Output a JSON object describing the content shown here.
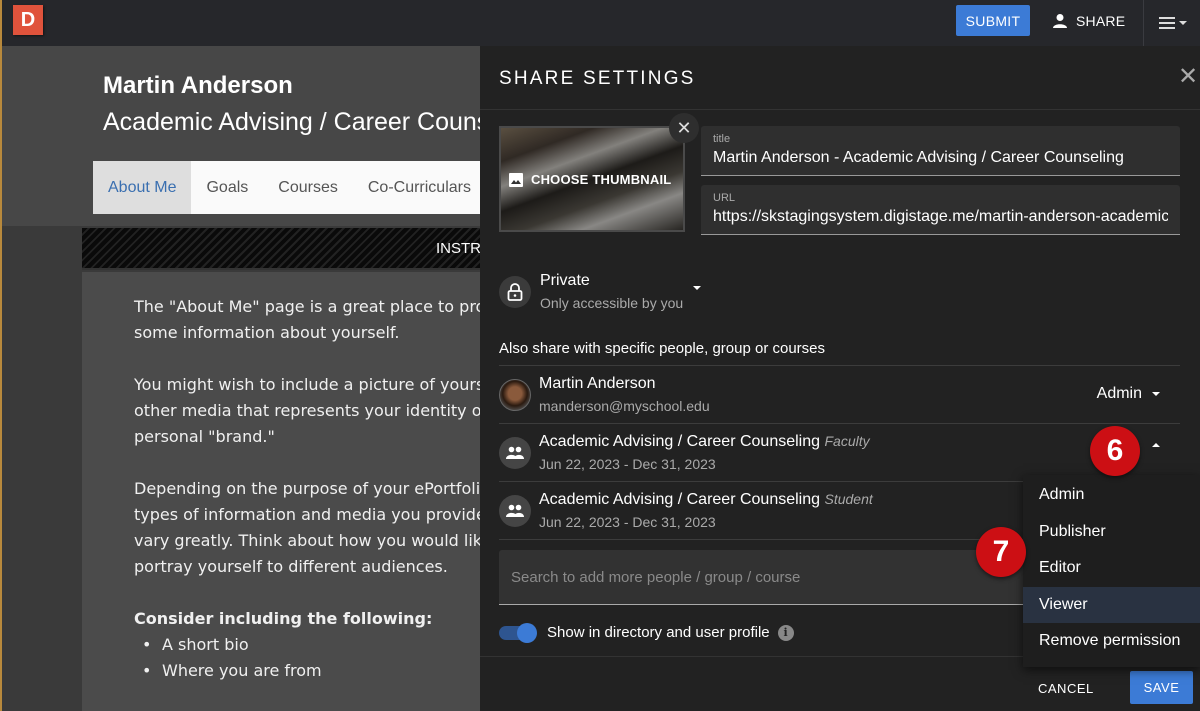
{
  "topbar": {
    "logo_letter": "D",
    "submit_label": "SUBMIT",
    "share_label": "SHARE",
    "menu_icon": "hamburger-menu-icon"
  },
  "page": {
    "name": "Martin Anderson",
    "subtitle": "Academic Advising / Career Counseling",
    "tabs": [
      {
        "label": "About Me",
        "active": true
      },
      {
        "label": "Goals",
        "active": false
      },
      {
        "label": "Courses",
        "active": false
      },
      {
        "label": "Co-Curriculars",
        "active": false
      }
    ],
    "instructions_label": "INSTRUCTIONS",
    "paragraphs": [
      [
        "The \"About Me\" page is a great place to provide",
        "some information about yourself."
      ],
      [
        "You might wish to include a picture of yourself or",
        "other media that represents your identity or",
        "personal \"brand.\""
      ],
      [
        "Depending on the purpose of your ePortfolio, the",
        "types of information and media you provide may",
        "vary greatly. Think about how you would like to",
        "portray yourself to different audiences."
      ]
    ],
    "consider_heading": "Consider including the following:",
    "bullets": [
      "A short bio",
      "Where you are from"
    ]
  },
  "share_settings": {
    "title": "SHARE SETTINGS",
    "thumbnail_label": "CHOOSE THUMBNAIL",
    "title_field": {
      "label": "title",
      "value": "Martin Anderson - Academic Advising / Career Counseling"
    },
    "url_field": {
      "label": "URL",
      "value": "https://skstagingsystem.digistage.me/martin-anderson-academic-advising-career-counseling"
    },
    "privacy": {
      "title": "Private",
      "subtitle": "Only accessible by you"
    },
    "share_with_label": "Also share with specific people, group or courses",
    "shares": [
      {
        "name": "Martin Anderson",
        "tag": "",
        "sub": "manderson@myschool.edu",
        "role": "Admin",
        "avatar": "photo"
      },
      {
        "name": "Academic Advising / Career Counseling",
        "tag": "Faculty",
        "sub": "Jun 22, 2023 - Dec 31, 2023",
        "role": "",
        "avatar": "group"
      },
      {
        "name": "Academic Advising / Career Counseling",
        "tag": "Student",
        "sub": "Jun 22, 2023 - Dec 31, 2023",
        "role": "",
        "avatar": "group"
      }
    ],
    "search_placeholder": "Search to add more people / group / course",
    "directory_toggle": {
      "label": "Show in directory and user profile",
      "on": true
    },
    "cancel_label": "CANCEL",
    "save_label": "SAVE"
  },
  "role_menu": {
    "options": [
      "Admin",
      "Publisher",
      "Editor",
      "Viewer",
      "Remove permission"
    ],
    "highlighted": "Viewer"
  },
  "step_markers": [
    "6",
    "7"
  ],
  "colors": {
    "accent_blue": "#3c7bd6",
    "logo_red": "#e0533c",
    "step_red": "#cc0f14",
    "panel_bg": "#222222"
  }
}
